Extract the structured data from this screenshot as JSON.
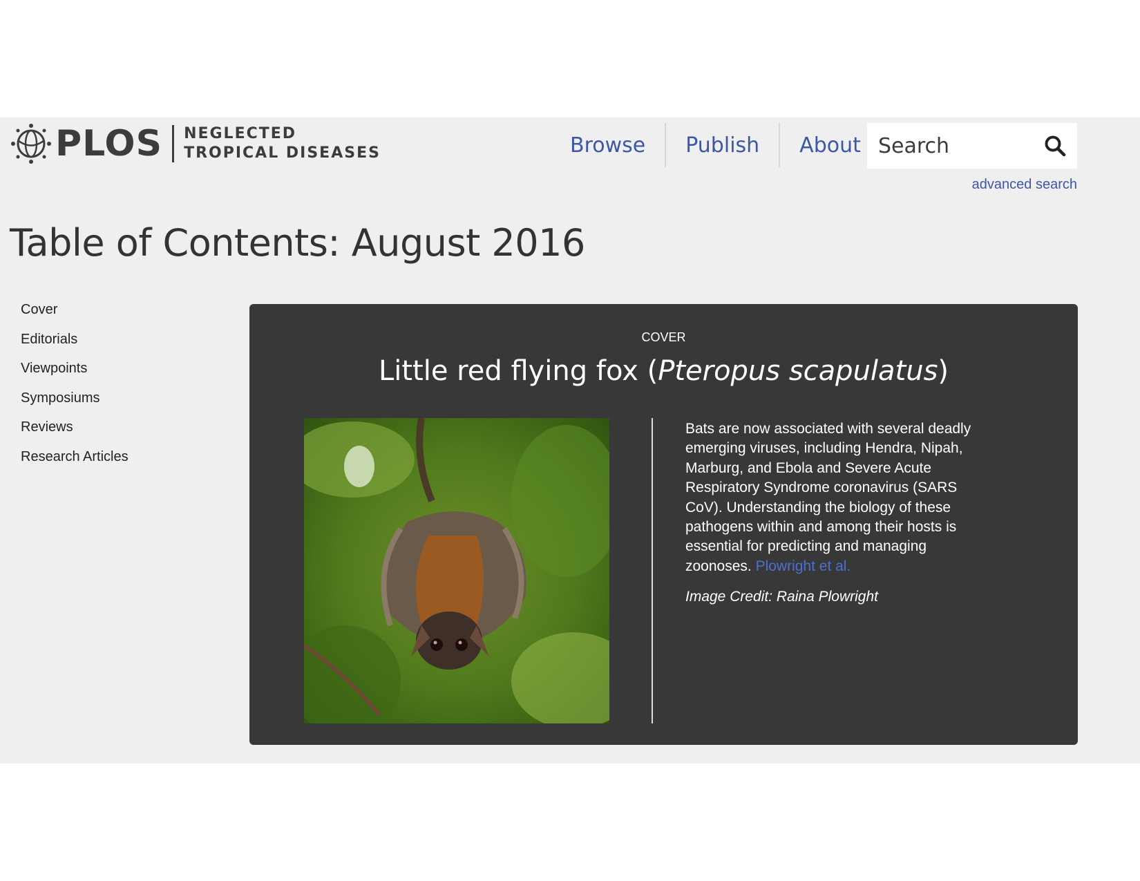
{
  "header": {
    "logo_text": "PLOS",
    "journal_line1": "NEGLECTED",
    "journal_line2": "TROPICAL DISEASES",
    "nav": [
      {
        "label": "Browse"
      },
      {
        "label": "Publish"
      },
      {
        "label": "About"
      }
    ],
    "search": {
      "placeholder": "Search"
    },
    "advanced_search": "advanced search"
  },
  "page_title": "Table of Contents: August 2016",
  "sidebar": {
    "items": [
      {
        "label": "Cover"
      },
      {
        "label": "Editorials"
      },
      {
        "label": "Viewpoints"
      },
      {
        "label": "Symposiums"
      },
      {
        "label": "Reviews"
      },
      {
        "label": "Research Articles"
      }
    ]
  },
  "cover": {
    "label": "COVER",
    "title_plain": "Little red flying fox (",
    "title_italic": "Pteropus scapulatus",
    "title_close": ")",
    "description": "Bats are now associated with several deadly emerging viruses, including Hendra, Nipah, Marburg, and Ebola and Severe Acute Respiratory Syndrome coronavirus (SARS CoV). Understanding the biology of these pathogens within and among their hosts is essential for predicting and managing zoonoses.",
    "link_text": "Plowright et al.",
    "credit": "Image Credit: Raina Plowright"
  },
  "colors": {
    "link": "#3d57a5",
    "card_bg": "#383838",
    "page_bg": "#efefef"
  },
  "icons": {
    "search": "search-icon",
    "logo": "plos-logo-icon"
  }
}
